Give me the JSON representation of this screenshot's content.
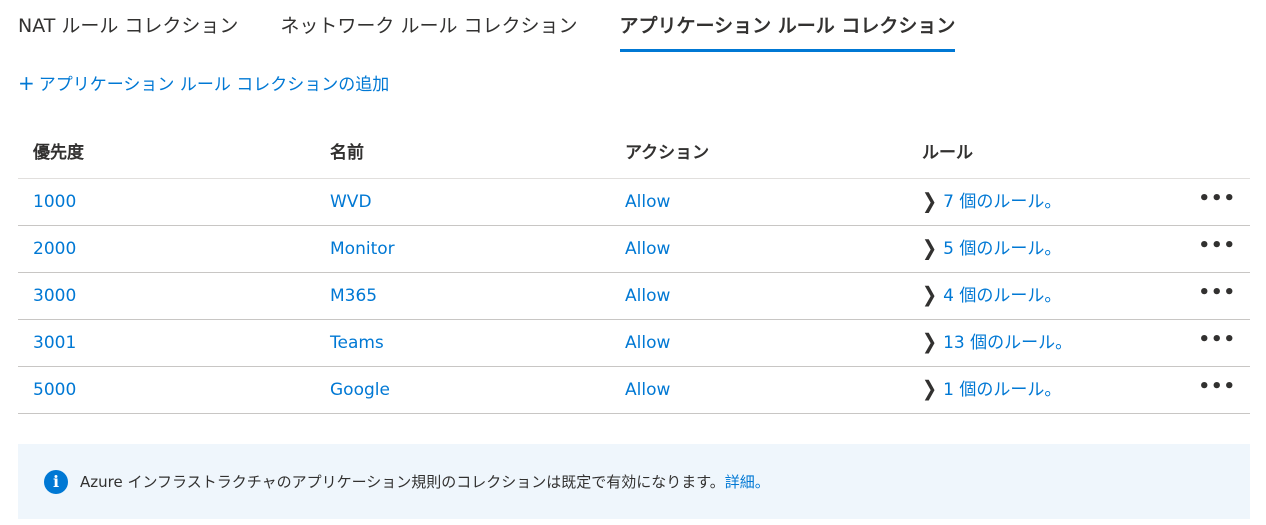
{
  "tabs": [
    {
      "label": "NAT ルール コレクション",
      "active": false
    },
    {
      "label": "ネットワーク ルール コレクション",
      "active": false
    },
    {
      "label": "アプリケーション ルール コレクション",
      "active": true
    }
  ],
  "add_link": {
    "icon": "plus-icon",
    "label": "アプリケーション ルール コレクションの追加"
  },
  "table": {
    "headers": [
      "優先度",
      "名前",
      "アクション",
      "ルール"
    ],
    "rows": [
      {
        "priority": "1000",
        "name": "WVD",
        "action": "Allow",
        "rules": "7 個のルール。"
      },
      {
        "priority": "2000",
        "name": "Monitor",
        "action": "Allow",
        "rules": "5 個のルール。"
      },
      {
        "priority": "3000",
        "name": "M365",
        "action": "Allow",
        "rules": "4 個のルール。"
      },
      {
        "priority": "3001",
        "name": "Teams",
        "action": "Allow",
        "rules": "13 個のルール。"
      },
      {
        "priority": "5000",
        "name": "Google",
        "action": "Allow",
        "rules": "1 個のルール。"
      }
    ],
    "row_icons": {
      "expand": "chevron-right-icon",
      "menu": "more-options-icon"
    }
  },
  "info": {
    "icon": "info-icon",
    "text": "Azure インフラストラクチャのアプリケーション規則のコレクションは既定で有効になります。",
    "link": "詳細。"
  },
  "colors": {
    "accent": "#0078d4",
    "text": "#323130",
    "info_bg": "#eff6fc",
    "divider": "#c8c6c4"
  }
}
